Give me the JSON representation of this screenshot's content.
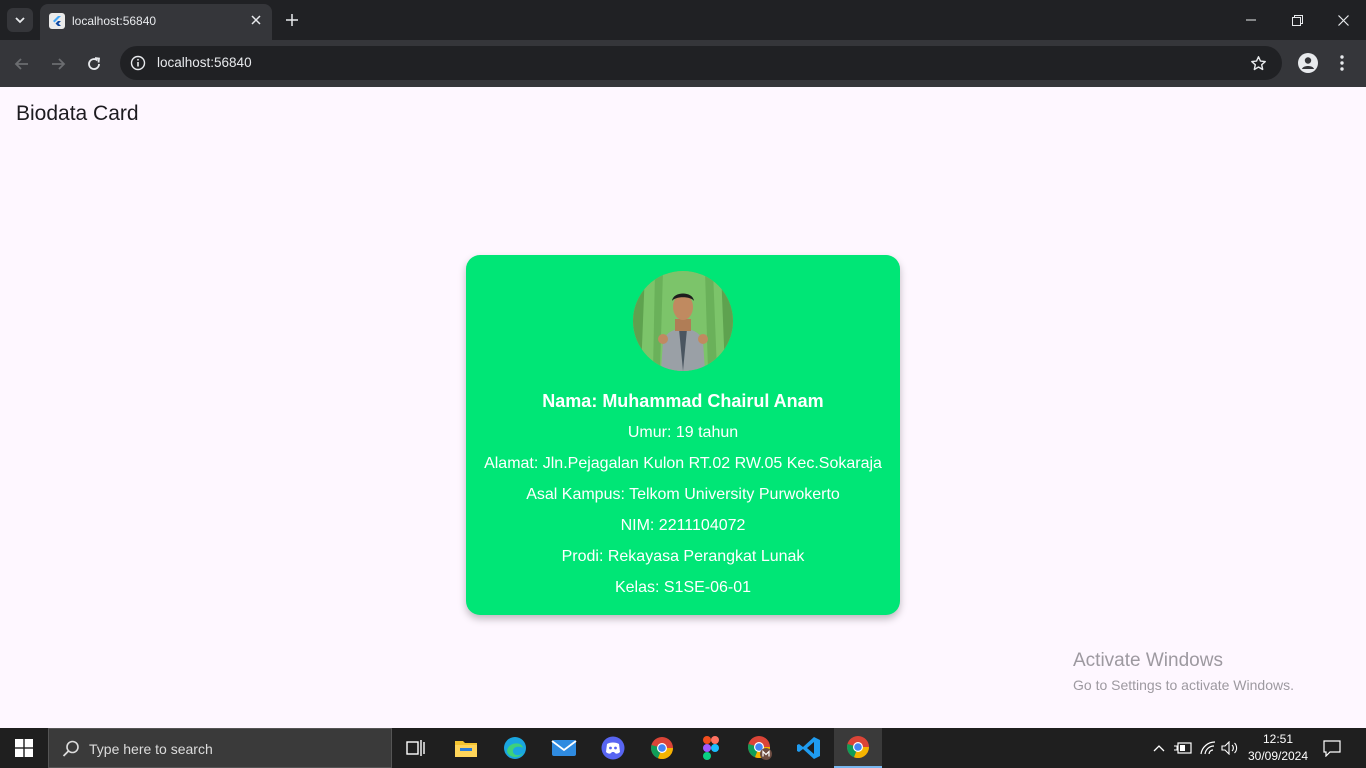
{
  "browser": {
    "tab_title": "localhost:56840",
    "url": "localhost:56840"
  },
  "app": {
    "title": "Biodata Card"
  },
  "card": {
    "name": "Nama: Muhammad Chairul Anam",
    "age": "Umur: 19 tahun",
    "address": "Alamat: Jln.Pejagalan Kulon RT.02 RW.05 Kec.Sokaraja",
    "campus": "Asal Kampus: Telkom University Purwokerto",
    "nim": "NIM: 2211104072",
    "prodi": "Prodi: Rekayasa Perangkat Lunak",
    "kelas": "Kelas: S1SE-06-01",
    "background_color": "#00e676"
  },
  "watermark": {
    "line1": "Activate Windows",
    "line2": "Go to Settings to activate Windows."
  },
  "taskbar": {
    "search_placeholder": "Type here to search",
    "time": "12:51",
    "date": "30/09/2024",
    "apps": [
      "task-view",
      "file-explorer",
      "edge",
      "mail",
      "discord",
      "chrome",
      "figma",
      "chrome-profile",
      "vscode",
      "chrome-active"
    ]
  }
}
